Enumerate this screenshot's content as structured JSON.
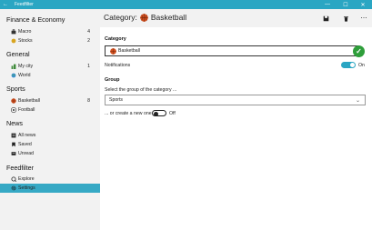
{
  "window": {
    "title": "Feedfilter",
    "back_glyph": "←",
    "minimize_glyph": "—",
    "maximize_glyph": "☐",
    "close_glyph": "✕"
  },
  "sidebar": {
    "groups": [
      {
        "name": "Finance & Economy",
        "items": [
          {
            "label": "Macro",
            "count": "4",
            "icon": "briefcase-icon"
          },
          {
            "label": "Stocks",
            "count": "2",
            "icon": "coins-icon"
          }
        ]
      },
      {
        "name": "General",
        "items": [
          {
            "label": "My city",
            "count": "1",
            "icon": "city-icon"
          },
          {
            "label": "World",
            "count": "",
            "icon": "globe-icon"
          }
        ]
      },
      {
        "name": "Sports",
        "items": [
          {
            "label": "Basketball",
            "count": "8",
            "icon": "basketball-icon"
          },
          {
            "label": "Football",
            "count": "",
            "icon": "football-icon"
          }
        ]
      },
      {
        "name": "News",
        "items": [
          {
            "label": "All news",
            "count": "",
            "icon": "list-icon"
          },
          {
            "label": "Saved",
            "count": "",
            "icon": "bookmark-icon"
          },
          {
            "label": "Unread",
            "count": "",
            "icon": "unread-icon"
          }
        ]
      },
      {
        "name": "Feedfilter",
        "items": [
          {
            "label": "Explore",
            "count": "",
            "icon": "explore-icon"
          },
          {
            "label": "Settings",
            "count": "",
            "icon": "gear-icon",
            "selected": true
          }
        ]
      }
    ]
  },
  "header": {
    "prefix": "Category:",
    "category_name": "Basketball",
    "save_glyph": "🖫",
    "delete_glyph": "🗑",
    "more_glyph": "⋯"
  },
  "form": {
    "category_label": "Category",
    "category_value": "Basketball",
    "notifications_label": "Notifications",
    "notifications_state": "On",
    "group_label": "Group",
    "select_prompt": "Select the group of the category ...",
    "group_selected": "Sports",
    "create_new_label": "... or create a new one",
    "create_new_state": "Off"
  },
  "colors": {
    "accent": "#2aa6c3",
    "selected_item": "#36a9c5",
    "success": "#2e9e3a",
    "sidebar_bg": "#f2f2f2"
  }
}
